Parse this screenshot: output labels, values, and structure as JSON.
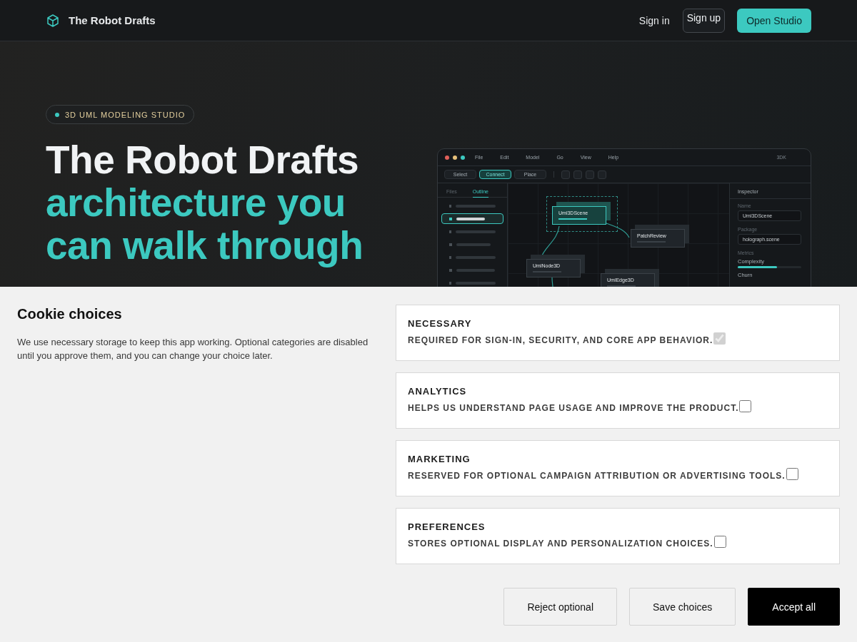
{
  "nav": {
    "brand": "The Robot Drafts",
    "links": [
      {
        "label": "Sign in",
        "kind": "link"
      },
      {
        "label": "Sign up",
        "kind": "outline"
      },
      {
        "label": "Open Studio",
        "kind": "primary"
      }
    ]
  },
  "hero": {
    "badge": "3D UML MODELING STUDIO",
    "title_lines": [
      {
        "text": "The Robot Drafts",
        "kind": "plain"
      },
      {
        "text": "architecture you",
        "kind": "accent"
      },
      {
        "text": "can walk through",
        "kind": "accent"
      }
    ]
  },
  "studio": {
    "traffic_lights": [
      {
        "color": "#e0605a"
      },
      {
        "color": "#e6c07a"
      },
      {
        "color": "#3cc9c0"
      }
    ],
    "menu": [
      "File",
      "Edit",
      "Model",
      "Go",
      "View",
      "Help"
    ],
    "mode_badge": "3DK",
    "tools": [
      {
        "label": "Select",
        "selected": false
      },
      {
        "label": "Connect",
        "selected": true
      },
      {
        "label": "Place",
        "selected": false
      }
    ],
    "sidebar_tabs": [
      {
        "label": "Files",
        "selected": false
      },
      {
        "label": "Outline",
        "selected": true
      }
    ],
    "outline_rows": [
      {
        "selected": false
      },
      {
        "selected": true
      },
      {
        "selected": false
      },
      {
        "selected": false
      },
      {
        "selected": false
      },
      {
        "selected": false
      },
      {
        "selected": false
      }
    ],
    "nodes": [
      {
        "label": "Uml3DScene",
        "selected": true
      },
      {
        "label": "PatchReview",
        "selected": false
      },
      {
        "label": "UmlNode3D",
        "selected": false
      },
      {
        "label": "UmlEdge3D",
        "selected": false
      }
    ],
    "inspector": {
      "title": "Inspector",
      "fields": [
        {
          "label": "Name",
          "value": "Uml3DScene"
        },
        {
          "label": "Package",
          "value": "holograph.scene"
        }
      ],
      "metrics_title": "Metrics",
      "metrics": [
        {
          "label": "Complexity",
          "level": 0.62
        },
        {
          "label": "Churn"
        }
      ]
    }
  },
  "cookie": {
    "title": "Cookie choices",
    "description": "We use necessary storage to keep this app working. Optional categories are disabled until you approve them, and you can change your choice later.",
    "categories": [
      {
        "name": "NECESSARY",
        "description": "REQUIRED FOR SIGN-IN, SECURITY, AND CORE APP BEHAVIOR.",
        "checked": true,
        "disabled": true
      },
      {
        "name": "ANALYTICS",
        "description": "HELPS US UNDERSTAND PAGE USAGE AND IMPROVE THE PRODUCT.",
        "checked": false,
        "disabled": false
      },
      {
        "name": "MARKETING",
        "description": "RESERVED FOR OPTIONAL CAMPAIGN ATTRIBUTION OR ADVERTISING TOOLS.",
        "checked": false,
        "disabled": false
      },
      {
        "name": "PREFERENCES",
        "description": "STORES OPTIONAL DISPLAY AND PERSONALIZATION CHOICES.",
        "checked": false,
        "disabled": false
      }
    ],
    "buttons": [
      {
        "label": "Reject optional",
        "kind": "secondary"
      },
      {
        "label": "Save choices",
        "kind": "secondary"
      },
      {
        "label": "Accept all",
        "kind": "primary"
      }
    ]
  }
}
